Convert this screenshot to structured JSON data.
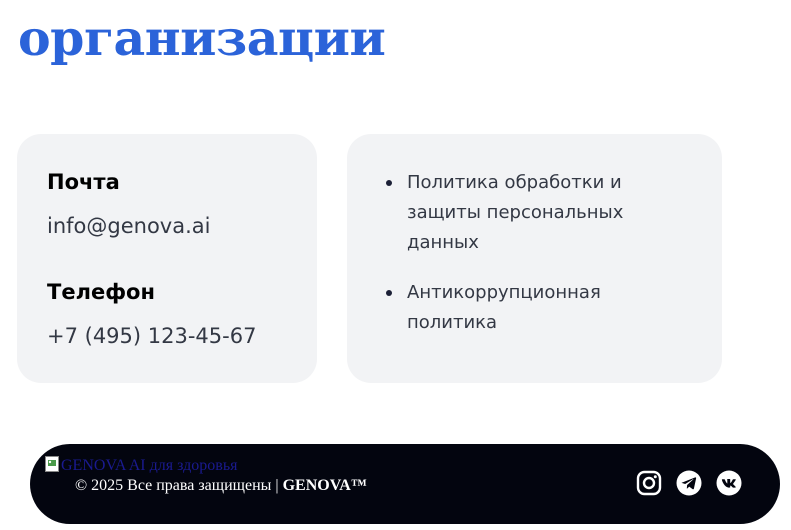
{
  "section": {
    "heading": "организации"
  },
  "contacts": {
    "email_label": "Почта",
    "email_value": "info@genova.ai",
    "phone_label": "Телефон",
    "phone_value": "+7 (495) 123-45-67"
  },
  "policies": {
    "items": [
      {
        "label": "Политика обработки и защиты персональных данных"
      },
      {
        "label": "Антикоррупционная политика"
      }
    ]
  },
  "footer": {
    "logo_alt": "GENOVA AI для здоровья",
    "copyright_prefix": "© 2025 Все права защищены | ",
    "brand": "GENOVA™",
    "social": [
      "instagram-icon",
      "telegram-icon",
      "vk-icon"
    ]
  },
  "colors": {
    "heading": "#2b63d9",
    "card_bg": "#f2f3f5",
    "footer_bg": "#03050f"
  }
}
